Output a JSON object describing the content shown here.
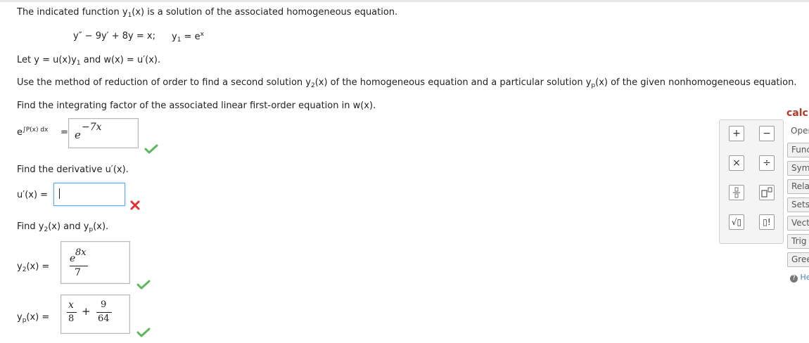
{
  "intro": {
    "line1": "The indicated function y",
    "line1_sub": "1",
    "line1_rest": "(x) is a solution of the associated homogeneous equation.",
    "equation": "y″ − 9y′ + 8y = x;",
    "y1_label": "y",
    "y1_sub": "1",
    "y1_value": " = e",
    "y1_exp": "x",
    "let_a": "Let y = u(x)y",
    "let_sub": "1",
    "let_b": " and w(x) = u′(x).",
    "method_a": "Use the method of reduction of order to find a second solution y",
    "method_sub2": "2",
    "method_b": "(x) of the homogeneous equation and a particular solution y",
    "method_subp": "p",
    "method_c": "(x) of the given nonhomogeneous equation."
  },
  "q1": {
    "prompt": "Find the integrating factor of the associated linear first-order equation in w(x).",
    "lhs_base": "e",
    "lhs_exp": "∫P(x) dx",
    "eq": "=",
    "answer_base": "e",
    "answer_exp": "−7x",
    "status": "correct"
  },
  "q2": {
    "prompt": "Find the derivative u′(x).",
    "lhs": "u′(x) =",
    "value": "",
    "status": "incorrect"
  },
  "q3": {
    "prompt_a": "Find y",
    "prompt_sub2": "2",
    "prompt_b": "(x) and y",
    "prompt_subp": "p",
    "prompt_c": "(x).",
    "y2_lhs": "y",
    "y2_sub": "2",
    "y2_rest": "(x)  =",
    "y2_num_base": "e",
    "y2_num_exp": "8x",
    "y2_den": "7",
    "y2_status": "correct",
    "yp_lhs": "y",
    "yp_sub": "p",
    "yp_rest": "(x)  =",
    "yp_t1_num": "x",
    "yp_t1_den": "8",
    "yp_plus": "+",
    "yp_t2_num": "9",
    "yp_t2_den": "64",
    "yp_status": "correct"
  },
  "palette": {
    "plus": "+",
    "minus": "−",
    "times": "×",
    "divide": "÷",
    "fraction": "fraction",
    "power": "power",
    "sqrt": "√▯",
    "factorial": "▯!"
  },
  "calc": {
    "title": "calc",
    "categories": [
      "Operations",
      "Functions",
      "Symbols",
      "Relations",
      "Sets",
      "Vectors",
      "Trig",
      "Greek"
    ],
    "help": "Help"
  },
  "colors": {
    "correct": "#5cb85c",
    "incorrect": "#e03030",
    "calc_title": "#b13a2c",
    "input_border": "#6aa6e8"
  }
}
